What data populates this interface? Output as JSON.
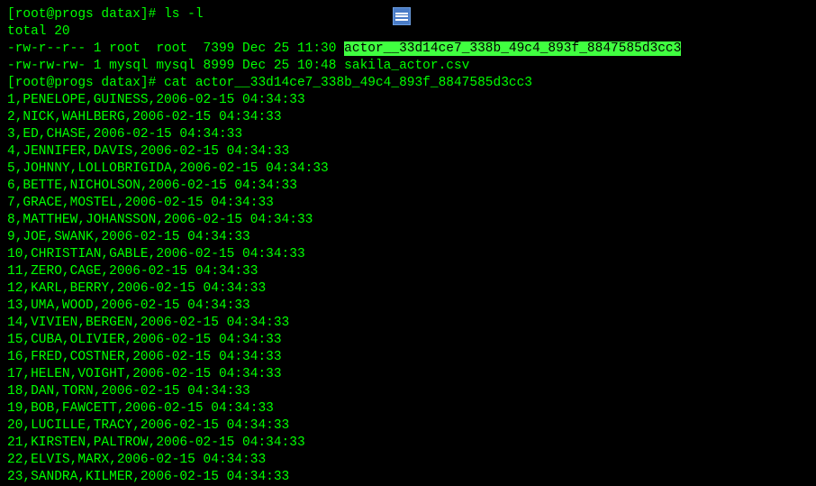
{
  "prompt1_user": "[root@progs datax]# ",
  "prompt1_cmd": "ls -l",
  "total_line": "total 20",
  "listing1_perm": "-rw-r--r-- 1 root  root  7399 Dec 25 11:30 ",
  "listing1_file_highlighted": "actor__33d14ce7_338b_49c4_893f_8847585d3cc3",
  "listing2": "-rw-rw-rw- 1 mysql mysql 8999 Dec 25 10:48 sakila_actor.csv",
  "prompt2_user": "[root@progs datax]# ",
  "prompt2_cmd": "cat actor__33d14ce7_338b_49c4_893f_8847585d3cc3",
  "rows": [
    "1,PENELOPE,GUINESS,2006-02-15 04:34:33",
    "2,NICK,WAHLBERG,2006-02-15 04:34:33",
    "3,ED,CHASE,2006-02-15 04:34:33",
    "4,JENNIFER,DAVIS,2006-02-15 04:34:33",
    "5,JOHNNY,LOLLOBRIGIDA,2006-02-15 04:34:33",
    "6,BETTE,NICHOLSON,2006-02-15 04:34:33",
    "7,GRACE,MOSTEL,2006-02-15 04:34:33",
    "8,MATTHEW,JOHANSSON,2006-02-15 04:34:33",
    "9,JOE,SWANK,2006-02-15 04:34:33",
    "10,CHRISTIAN,GABLE,2006-02-15 04:34:33",
    "11,ZERO,CAGE,2006-02-15 04:34:33",
    "12,KARL,BERRY,2006-02-15 04:34:33",
    "13,UMA,WOOD,2006-02-15 04:34:33",
    "14,VIVIEN,BERGEN,2006-02-15 04:34:33",
    "15,CUBA,OLIVIER,2006-02-15 04:34:33",
    "16,FRED,COSTNER,2006-02-15 04:34:33",
    "17,HELEN,VOIGHT,2006-02-15 04:34:33",
    "18,DAN,TORN,2006-02-15 04:34:33",
    "19,BOB,FAWCETT,2006-02-15 04:34:33",
    "20,LUCILLE,TRACY,2006-02-15 04:34:33",
    "21,KIRSTEN,PALTROW,2006-02-15 04:34:33",
    "22,ELVIS,MARX,2006-02-15 04:34:33",
    "23,SANDRA,KILMER,2006-02-15 04:34:33"
  ]
}
